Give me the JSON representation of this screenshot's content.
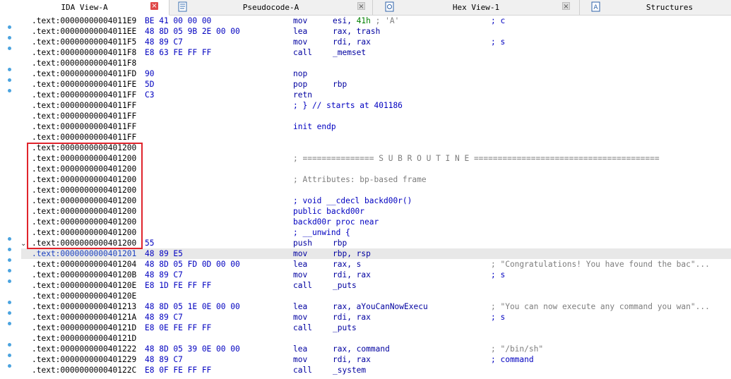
{
  "tabs": [
    {
      "label": "IDA View-A",
      "close": "×"
    },
    {
      "label": "Pseudocode-A",
      "close": "×"
    },
    {
      "label": "Hex View-1",
      "close": "×"
    },
    {
      "label": "Structures"
    }
  ],
  "colors": {
    "selection_box": "#e0242c",
    "address": "#000000",
    "instruction": "#0000a0",
    "comment": "#7d7d7d"
  },
  "listing": [
    {
      "addr": ".text:00000000004011E9",
      "bytes": "BE 41 00 00 00",
      "mnem": "mov",
      "ops": "esi, ",
      "num": "41h",
      "chr": " ; 'A'",
      "rc": "; c",
      "rcc": "blue"
    },
    {
      "addr": ".text:00000000004011EE",
      "bytes": "48 8D 05 9B 2E 00 00",
      "mnem": "lea",
      "ops": "rax, trash"
    },
    {
      "addr": ".text:00000000004011F5",
      "bytes": "48 89 C7",
      "mnem": "mov",
      "ops": "rdi, rax",
      "rc": "; s",
      "rcc": "blue"
    },
    {
      "addr": ".text:00000000004011F8",
      "bytes": "E8 63 FE FF FF",
      "mnem": "call",
      "ops": "_memset"
    },
    {
      "addr": ".text:00000000004011F8"
    },
    {
      "addr": ".text:00000000004011FD",
      "bytes": "90",
      "mnem": "nop"
    },
    {
      "addr": ".text:00000000004011FE",
      "bytes": "5D",
      "mnem": "pop",
      "ops": "rbp"
    },
    {
      "addr": ".text:00000000004011FF",
      "bytes": "C3",
      "mnem": "retn"
    },
    {
      "addr": ".text:00000000004011FF",
      "full": "; } // starts at 401186",
      "fc": "blue"
    },
    {
      "addr": ".text:00000000004011FF"
    },
    {
      "addr": ".text:00000000004011FF",
      "full": "init endp",
      "fc": "blue"
    },
    {
      "addr": ".text:00000000004011FF"
    },
    {
      "addr": ".text:0000000000401200"
    },
    {
      "addr": ".text:0000000000401200",
      "full": "; =============== S U B R O U T I N E =======================================",
      "fc": "gray"
    },
    {
      "addr": ".text:0000000000401200"
    },
    {
      "addr": ".text:0000000000401200",
      "full": "; Attributes: bp-based frame",
      "fc": "gray"
    },
    {
      "addr": ".text:0000000000401200"
    },
    {
      "addr": ".text:0000000000401200",
      "full": "; void __cdecl backd00r()",
      "fc": "blue"
    },
    {
      "addr": ".text:0000000000401200",
      "full": "public backd00r",
      "fc": "blue"
    },
    {
      "addr": ".text:0000000000401200",
      "full": "backd00r proc near",
      "fc": "blue"
    },
    {
      "addr": ".text:0000000000401200",
      "full": "; __unwind {",
      "fc": "blue"
    },
    {
      "addr": ".text:0000000000401200",
      "bytes": "55",
      "mnem": "push",
      "ops": "rbp"
    },
    {
      "addr": ".text:0000000000401201",
      "bytes": "48 89 E5",
      "mnem": "mov",
      "ops": "rbp, rsp",
      "hl": true
    },
    {
      "addr": ".text:0000000000401204",
      "bytes": "48 8D 05 FD 0D 00 00",
      "mnem": "lea",
      "ops": "rax, s",
      "rc": "; \"Congratulations! You have found the bac\"...",
      "rcc": "gray"
    },
    {
      "addr": ".text:000000000040120B",
      "bytes": "48 89 C7",
      "mnem": "mov",
      "ops": "rdi, rax",
      "rc": "; s",
      "rcc": "blue"
    },
    {
      "addr": ".text:000000000040120E",
      "bytes": "E8 1D FE FF FF",
      "mnem": "call",
      "ops": "_puts"
    },
    {
      "addr": ".text:000000000040120E"
    },
    {
      "addr": ".text:0000000000401213",
      "bytes": "48 8D 05 1E 0E 00 00",
      "mnem": "lea",
      "ops": "rax, aYouCanNowExecu",
      "rc": "; \"You can now execute any command you wan\"...",
      "rcc": "gray"
    },
    {
      "addr": ".text:000000000040121A",
      "bytes": "48 89 C7",
      "mnem": "mov",
      "ops": "rdi, rax",
      "rc": "; s",
      "rcc": "blue"
    },
    {
      "addr": ".text:000000000040121D",
      "bytes": "E8 0E FE FF FF",
      "mnem": "call",
      "ops": "_puts"
    },
    {
      "addr": ".text:000000000040121D"
    },
    {
      "addr": ".text:0000000000401222",
      "bytes": "48 8D 05 39 0E 00 00",
      "mnem": "lea",
      "ops": "rax, command",
      "rc": "; \"/bin/sh\"",
      "rcc": "gray"
    },
    {
      "addr": ".text:0000000000401229",
      "bytes": "48 89 C7",
      "mnem": "mov",
      "ops": "rdi, rax",
      "rc": "; command",
      "rcc": "blue"
    },
    {
      "addr": ".text:000000000040122C",
      "bytes": "E8 0F FE FF FF",
      "mnem": "call",
      "ops": "_system"
    }
  ]
}
